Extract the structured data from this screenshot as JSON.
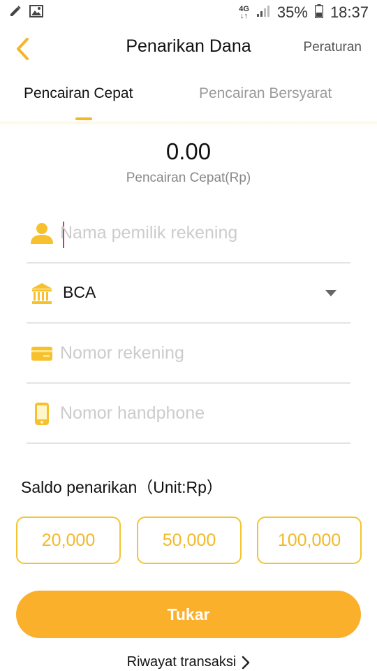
{
  "status_bar": {
    "network_top": "4G",
    "network_bottom": "↓↑",
    "battery": "35%",
    "time": "18:37"
  },
  "header": {
    "title": "Penarikan Dana",
    "rules_label": "Peraturan"
  },
  "tabs": [
    {
      "label": "Pencairan Cepat",
      "active": true
    },
    {
      "label": "Pencairan Bersyarat",
      "active": false
    }
  ],
  "balance": {
    "amount": "0.00",
    "label": "Pencairan Cepat(Rp)"
  },
  "form": {
    "account_holder": {
      "value": "",
      "placeholder": "Nama pemilik rekening"
    },
    "bank": {
      "value": "BCA"
    },
    "account_number": {
      "value": "",
      "placeholder": "Nomor rekening"
    },
    "phone": {
      "value": "",
      "placeholder": "Nomor handphone"
    }
  },
  "withdrawal": {
    "label": "Saldo penarikan（Unit:Rp）",
    "options": [
      "20,000",
      "50,000",
      "100,000"
    ]
  },
  "submit_label": "Tukar",
  "history_label": "Riwayat transaksi",
  "colors": {
    "accent": "#fbb02c",
    "icon": "#f6c12d"
  }
}
